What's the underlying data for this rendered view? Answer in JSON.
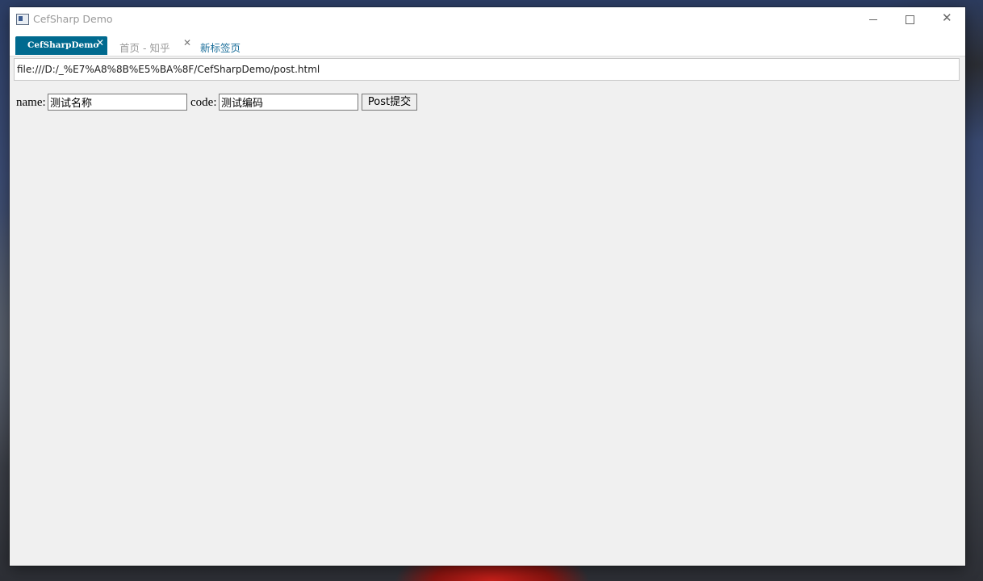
{
  "window": {
    "title": "CefSharp Demo"
  },
  "title_controls": {
    "minimize": "minimize",
    "maximize": "maximize",
    "close": "✕"
  },
  "tabs": [
    {
      "label": "CefSharpDemo",
      "close": "✕",
      "active": true
    },
    {
      "label": "首页 - 知乎",
      "close": "✕",
      "active": false
    }
  ],
  "new_tab_label": "新标签页",
  "address": {
    "url": "file:///D:/_%E7%A8%8B%E5%BA%8F/CefSharpDemo/post.html"
  },
  "form": {
    "name_label": "name:",
    "name_value": "测试名称",
    "code_label": "code:",
    "code_value": "测试编码",
    "submit_label": "Post提交"
  },
  "colors": {
    "active_tab": "#006a8f",
    "new_tab_link": "#1a6e9a",
    "page_background": "#f0f0f0"
  }
}
